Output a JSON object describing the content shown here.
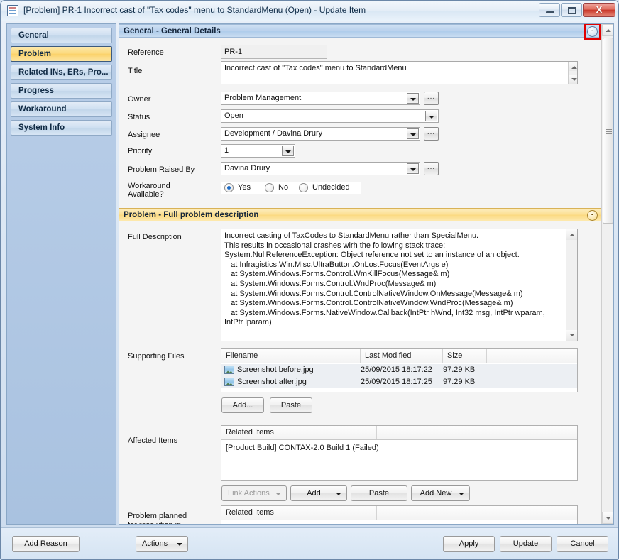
{
  "window": {
    "title": "[Problem] PR-1 Incorrect cast of \"Tax codes\" menu to StandardMenu (Open) - Update Item",
    "icon": "document-icon",
    "minimize_label": "",
    "maximize_label": "",
    "close_label": "X"
  },
  "sidebar": {
    "items": [
      {
        "label": "General",
        "selected": false
      },
      {
        "label": "Problem",
        "selected": true
      },
      {
        "label": "Related INs, ERs, Pro...",
        "selected": false
      },
      {
        "label": "Progress",
        "selected": false
      },
      {
        "label": "Workaround",
        "selected": false
      },
      {
        "label": "System Info",
        "selected": false
      }
    ]
  },
  "sections": {
    "general": {
      "header": "General - General Details",
      "collapse_glyph": "-",
      "fields": {
        "reference_label": "Reference",
        "reference_value": "PR-1",
        "title_label": "Title",
        "title_value": "Incorrect cast of \"Tax codes\" menu to StandardMenu",
        "owner_label": "Owner",
        "owner_value": "Problem Management",
        "status_label": "Status",
        "status_value": "Open",
        "assignee_label": "Assignee",
        "assignee_value": "Development / Davina Drury",
        "priority_label": "Priority",
        "priority_value": "1",
        "raised_by_label": "Problem Raised By",
        "raised_by_value": "Davina Drury",
        "workaround_label": "Workaround Available?",
        "workaround_options": [
          {
            "label": "Yes",
            "selected": true
          },
          {
            "label": "No",
            "selected": false
          },
          {
            "label": "Undecided",
            "selected": false
          }
        ],
        "ellipsis_label": "..."
      }
    },
    "problem": {
      "header": "Problem - Full problem description",
      "collapse_glyph": "-",
      "full_description_label": "Full Description",
      "full_description_value": "Incorrect casting of TaxCodes to StandardMenu rather than SpecialMenu.\nThis results in occasional crashes wirh the following stack trace:\nSystem.NullReferenceException: Object reference not set to an instance of an object.\n   at Infragistics.Win.Misc.UltraButton.OnLostFocus(EventArgs e)\n   at System.Windows.Forms.Control.WmKillFocus(Message& m)\n   at System.Windows.Forms.Control.WndProc(Message& m)\n   at System.Windows.Forms.Control.ControlNativeWindow.OnMessage(Message& m)\n   at System.Windows.Forms.Control.ControlNativeWindow.WndProc(Message& m)\n   at System.Windows.Forms.NativeWindow.Callback(IntPtr hWnd, Int32 msg, IntPtr wparam, IntPtr lparam)",
      "supporting_files_label": "Supporting Files",
      "supporting_files_columns": [
        "Filename",
        "Last Modified",
        "Size",
        ""
      ],
      "supporting_files_rows": [
        {
          "icon": "image-file-icon",
          "filename": "Screenshot before.jpg",
          "last_modified": "25/09/2015 18:17:22",
          "size": "97.29 KB"
        },
        {
          "icon": "image-file-icon",
          "filename": "Screenshot after.jpg",
          "last_modified": "25/09/2015 18:17:25",
          "size": "97.29 KB"
        }
      ],
      "supporting_files_buttons": [
        {
          "label": "Add...",
          "disabled": false
        },
        {
          "label": "Paste",
          "disabled": false
        }
      ],
      "affected_items_label": "Affected Items",
      "affected_items_columns": [
        "Related Items",
        ""
      ],
      "affected_items_rows": [
        {
          "text": "[Product Build] CONTAX-2.0 Build 1 (Failed)"
        }
      ],
      "affected_items_buttons": [
        {
          "label": "Link Actions",
          "split": true,
          "disabled": true
        },
        {
          "label": "Add",
          "split": true,
          "disabled": false
        },
        {
          "label": "Paste",
          "split": false,
          "disabled": false
        },
        {
          "label": "Add New",
          "split": true,
          "disabled": false
        }
      ],
      "planned_label": "Problem planned\nfor resolution in",
      "planned_columns": [
        "Related Items",
        ""
      ]
    }
  },
  "footer": {
    "add_reason": {
      "pre": "Add ",
      "accel": "R",
      "post": "eason"
    },
    "actions": {
      "pre": "A",
      "accel": "c",
      "post": "tions"
    },
    "apply": {
      "pre": "",
      "accel": "A",
      "post": "pply"
    },
    "update": {
      "pre": "",
      "accel": "U",
      "post": "pdate"
    },
    "cancel": {
      "pre": "",
      "accel": "C",
      "post": "ancel"
    }
  },
  "colors": {
    "accent_blue": "#b9d1ec",
    "accent_gold": "#fcd97c",
    "highlight_red": "#e00000",
    "selection_row": "#eceff3"
  }
}
